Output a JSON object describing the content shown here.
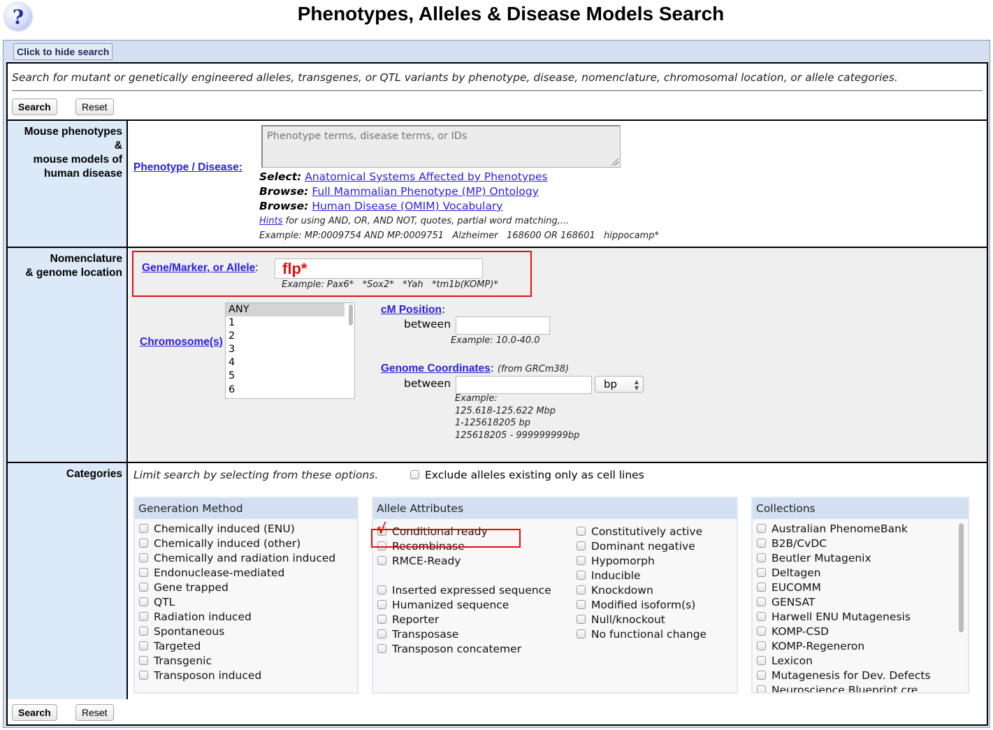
{
  "header": {
    "help_icon": "question-mark-icon",
    "title": "Phenotypes, Alleles & Disease Models Search"
  },
  "toggle": {
    "label": "Click to hide search"
  },
  "intro": {
    "text": "Search for mutant or genetically engineered alleles, transgenes, or QTL variants by phenotype, disease, nomenclature, chromosomal location, or allele categories.",
    "search_label": "Search",
    "reset_label": "Reset"
  },
  "phenotype": {
    "section_label_1": "Mouse phenotypes",
    "section_label_2": "&",
    "section_label_3": "mouse models of",
    "section_label_4": "human disease",
    "field_label": "Phenotype / Disease:",
    "placeholder": "Phenotype terms, disease terms, or IDs",
    "value": "",
    "select_lead": "Select:",
    "select_link": "Anatomical Systems Affected by Phenotypes",
    "browse1_lead": "Browse:",
    "browse1_link": "Full Mammalian Phenotype (MP) Ontology",
    "browse2_lead": "Browse:",
    "browse2_link": "Human Disease (OMIM) Vocabulary",
    "hints_link": "Hints",
    "hints_text": " for using AND, OR, AND NOT, quotes, partial word matching,...",
    "example": "Example: MP:0009754 AND MP:0009751   Alzheimer   168600 OR 168601   hippocamp*"
  },
  "nomenclature": {
    "section_label_1": "Nomenclature",
    "section_label_2": "& genome location",
    "gene_label": "Gene/Marker, or Allele",
    "gene_value": "flp*",
    "gene_example": "Example: Pax6*   *Sox2*   *Yah   *tm1b(KOMP)*",
    "chromosome_label": "Chromosome(s)",
    "chromosome_options": [
      "ANY",
      "1",
      "2",
      "3",
      "4",
      "5",
      "6"
    ],
    "chromosome_selected": "ANY",
    "cm_label": "cM Position",
    "cm_between": "between",
    "cm_value": "",
    "cm_example": "Example: 10.0-40.0",
    "coord_label": "Genome Coordinates",
    "coord_note": "(from GRCm38)",
    "coord_between": "between",
    "coord_value": "",
    "coord_unit": "bp",
    "coord_example_1": "Example:",
    "coord_example_2": "125.618-125.622 Mbp",
    "coord_example_3": "1-125618205 bp",
    "coord_example_4": "125618205 - 999999999bp"
  },
  "categories": {
    "section_label": "Categories",
    "intro": "Limit search by selecting from these options.",
    "exclude_label": "Exclude alleles existing only as cell lines",
    "exclude_checked": false,
    "generation": {
      "title": "Generation Method",
      "items": [
        {
          "label": "Chemically induced (ENU)",
          "checked": false
        },
        {
          "label": "Chemically induced (other)",
          "checked": false
        },
        {
          "label": "Chemically and radiation induced",
          "checked": false
        },
        {
          "label": "Endonuclease-mediated",
          "checked": false
        },
        {
          "label": "Gene trapped",
          "checked": false
        },
        {
          "label": "QTL",
          "checked": false
        },
        {
          "label": "Radiation induced",
          "checked": false
        },
        {
          "label": "Spontaneous",
          "checked": false
        },
        {
          "label": "Targeted",
          "checked": false
        },
        {
          "label": "Transgenic",
          "checked": false
        },
        {
          "label": "Transposon induced",
          "checked": false
        }
      ]
    },
    "attributes": {
      "title": "Allele Attributes",
      "col1": [
        {
          "label": "Conditional ready",
          "checked": false
        },
        {
          "label": "Recombinase",
          "checked": true
        },
        {
          "label": "RMCE-Ready",
          "checked": false
        },
        {
          "label": "",
          "checked": false
        },
        {
          "label": "Inserted expressed sequence",
          "checked": false
        },
        {
          "label": "Humanized sequence",
          "checked": false
        },
        {
          "label": "Reporter",
          "checked": false
        },
        {
          "label": "Transposase",
          "checked": false
        },
        {
          "label": "Transposon concatemer",
          "checked": false
        }
      ],
      "col2": [
        {
          "label": "Constitutively active",
          "checked": false
        },
        {
          "label": "Dominant negative",
          "checked": false
        },
        {
          "label": "Hypomorph",
          "checked": false
        },
        {
          "label": "Inducible",
          "checked": false
        },
        {
          "label": "Knockdown",
          "checked": false
        },
        {
          "label": "Modified isoform(s)",
          "checked": false
        },
        {
          "label": "Null/knockout",
          "checked": false
        },
        {
          "label": "No functional change",
          "checked": false
        }
      ],
      "check_mark": "√"
    },
    "collections": {
      "title": "Collections",
      "items": [
        {
          "label": "Australian PhenomeBank",
          "checked": false
        },
        {
          "label": "B2B/CvDC",
          "checked": false
        },
        {
          "label": "Beutler Mutagenix",
          "checked": false
        },
        {
          "label": "Deltagen",
          "checked": false
        },
        {
          "label": "EUCOMM",
          "checked": false
        },
        {
          "label": "GENSAT",
          "checked": false
        },
        {
          "label": "Harwell ENU Mutagenesis",
          "checked": false
        },
        {
          "label": "KOMP-CSD",
          "checked": false
        },
        {
          "label": "KOMP-Regeneron",
          "checked": false
        },
        {
          "label": "Lexicon",
          "checked": false
        },
        {
          "label": "Mutagenesis for Dev. Defects",
          "checked": false
        },
        {
          "label": "Neuroscience Blueprint cre",
          "checked": false
        }
      ]
    }
  },
  "footer": {
    "search_label": "Search",
    "reset_label": "Reset"
  },
  "colors": {
    "link": "#2b1ee0",
    "highlight": "#e01010",
    "label_bg": "#dce9f9",
    "panel_head": "#d3e0f1"
  }
}
